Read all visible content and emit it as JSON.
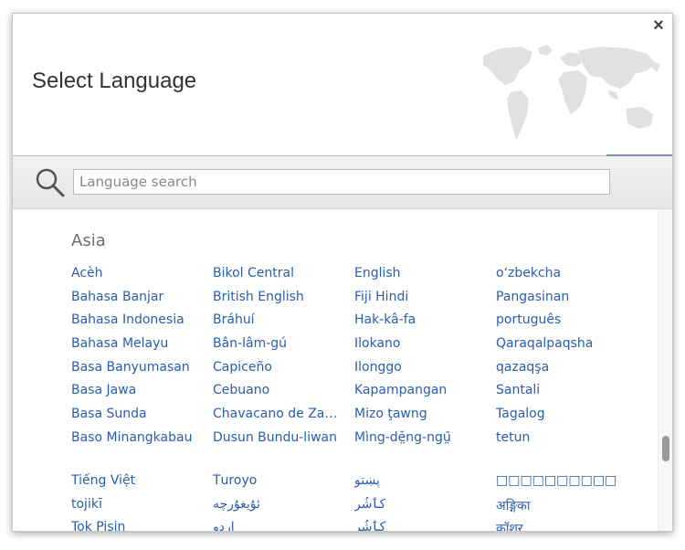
{
  "dialog": {
    "title": "Select Language",
    "close_label": "×",
    "search": {
      "placeholder": "Language search",
      "value": ""
    }
  },
  "region": {
    "name": "Asia"
  },
  "languages_block1": [
    "Acèh",
    "Bikol Central",
    "English",
    "oʻzbekcha",
    "Bahasa Banjar",
    "British English",
    "Fiji Hindi",
    "Pangasinan",
    "Bahasa Indonesia",
    "Bráhuí",
    "Hak-kâ-fa",
    "português",
    "Bahasa Melayu",
    "Bân-lâm-gú",
    "Ilokano",
    "Qaraqalpaqsha",
    "Basa Banyumasan",
    "Capiceño",
    "Ilonggo",
    "qazaqşa",
    "Basa Jawa",
    "Cebuano",
    "Kapampangan",
    "Santali",
    "Basa Sunda",
    "Chavacano de Zamboanga",
    "Mizo ţawng",
    "Tagalog",
    "Baso Minangkabau",
    "Dusun Bundu-liwan",
    "Mìng-dĕ̤ng-ngṳ̄",
    "tetun"
  ],
  "languages_block2": [
    "Tiếng Việt",
    "Ṫuroyo",
    "پښتو",
    "□□□□□□□□□□",
    "tojikī",
    "ئۇيغۇرچە",
    "کٲشُر",
    "अङ्गिका",
    "Tok Pisin",
    "اردو",
    "کٲشُر",
    "कॉशुर"
  ],
  "colors": {
    "link": "#2a5db0",
    "title": "#333333",
    "region": "#6e6e6e"
  }
}
